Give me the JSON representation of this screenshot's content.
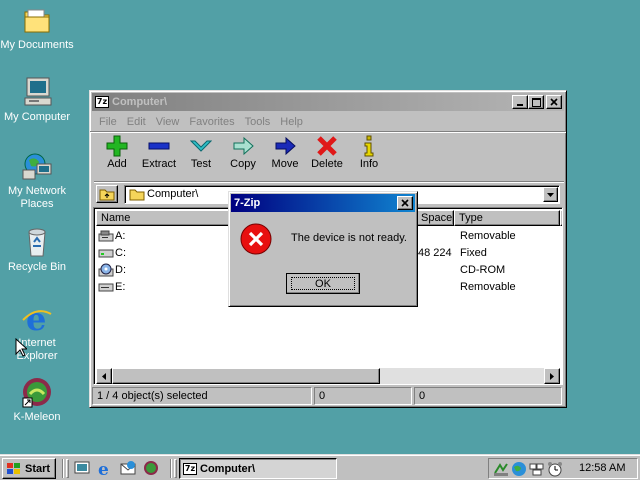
{
  "desktop": {
    "icons": [
      {
        "label": "My Documents"
      },
      {
        "label": "My Computer"
      },
      {
        "label": "My Network Places"
      },
      {
        "label": "Recycle Bin"
      },
      {
        "label": "Internet Explorer"
      },
      {
        "label": "K-Meleon"
      }
    ]
  },
  "window": {
    "title": "Computer\\",
    "app_icon": "7z",
    "menu": [
      "File",
      "Edit",
      "View",
      "Favorites",
      "Tools",
      "Help"
    ],
    "toolbar": [
      "Add",
      "Extract",
      "Test",
      "Copy",
      "Move",
      "Delete",
      "Info"
    ],
    "address": "Computer\\",
    "columns": [
      "Name",
      "Space",
      "Type"
    ],
    "rows": [
      {
        "name": "A:",
        "space": "",
        "type": "Removable",
        "icon": "floppy-drive-icon"
      },
      {
        "name": "C:",
        "space": "48 224",
        "type": "Fixed",
        "icon": "hard-drive-icon"
      },
      {
        "name": "D:",
        "space": "",
        "type": "CD-ROM",
        "icon": "cdrom-drive-icon"
      },
      {
        "name": "E:",
        "space": "",
        "type": "Removable",
        "icon": "removable-drive-icon"
      }
    ],
    "status": [
      "1 / 4 object(s) selected",
      "0",
      "0"
    ]
  },
  "dialog": {
    "title": "7-Zip",
    "message": "The device is not ready.",
    "ok_label": "OK",
    "close_label": "X"
  },
  "taskbar": {
    "start_label": "Start",
    "task_label": "Computer\\",
    "clock": "12:58 AM"
  },
  "colors": {
    "desktop": "#52a0a6",
    "titlebar_active": "#000080",
    "error_red": "#e81010"
  }
}
